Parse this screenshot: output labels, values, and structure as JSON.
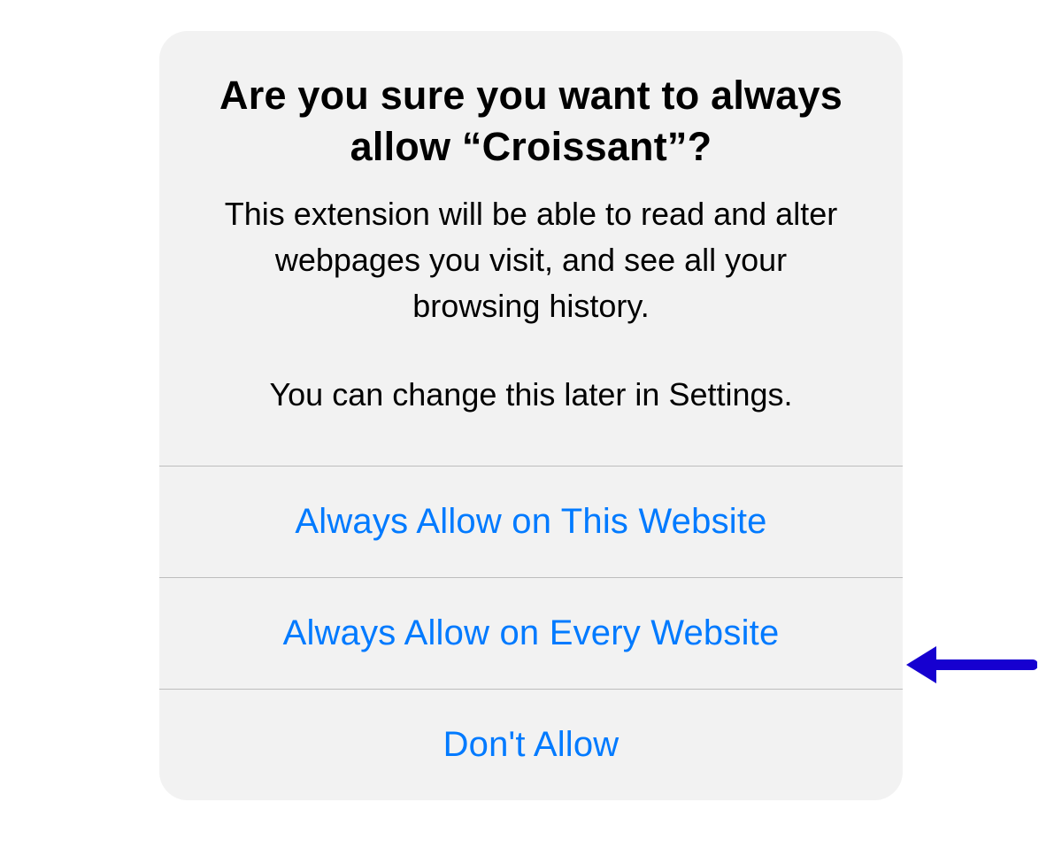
{
  "alert": {
    "title": "Are you sure you want to always allow “Croissant”?",
    "message_line1": "This extension will be able to read and alter webpages you visit, and see all your browsing history.",
    "message_line2": "You can change this later in Settings.",
    "buttons": [
      {
        "id": "always-this-website",
        "label": "Always Allow on This Website"
      },
      {
        "id": "always-every-website",
        "label": "Always Allow on Every Website"
      },
      {
        "id": "dont-allow",
        "label": "Don't Allow"
      }
    ]
  },
  "annotation": {
    "arrow_target": "always-every-website",
    "arrow_color": "#1600d0"
  }
}
